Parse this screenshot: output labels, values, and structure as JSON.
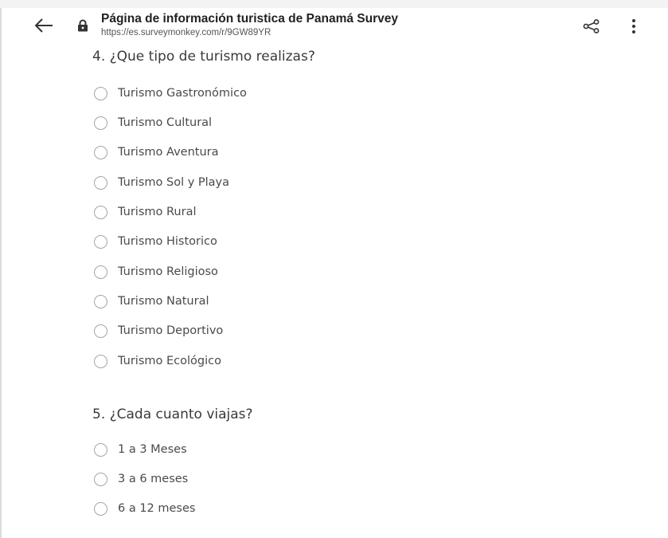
{
  "header": {
    "title": "Página de información turistica de Panamá Survey",
    "url": "https://es.surveymonkey.com/r/9GW89YR",
    "icons": {
      "back": "arrow-left-icon",
      "lock": "lock-icon",
      "share": "share-icon",
      "menu": "more-vert-icon"
    }
  },
  "questions": [
    {
      "title": "4. ¿Que tipo de turismo realizas?",
      "options": [
        "Turismo Gastronómico",
        "Turismo Cultural",
        "Turismo Aventura",
        "Turismo Sol y Playa",
        "Turismo Rural",
        "Turismo Historico",
        "Turismo Religioso",
        "Turismo Natural",
        "Turismo Deportivo",
        "Turismo Ecológico"
      ]
    },
    {
      "title": "5. ¿Cada cuanto viajas?",
      "options": [
        "1 a 3 Meses",
        "3 a 6 meses",
        "6 a 12 meses"
      ]
    }
  ],
  "colors": {
    "text": "#4a4a4a",
    "title": "#222222",
    "radio_border": "#a4a4a4"
  }
}
